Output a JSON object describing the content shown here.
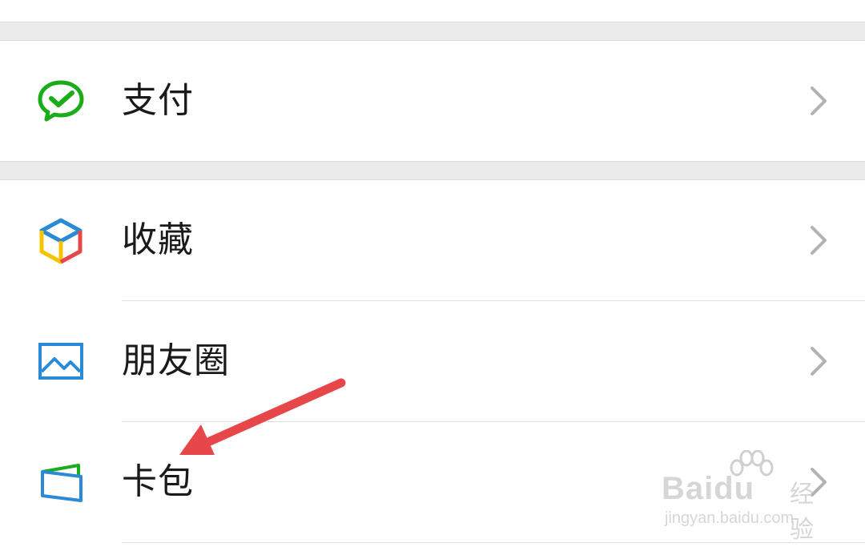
{
  "menu": {
    "items": [
      {
        "label": "支付",
        "icon": "wechat-pay-icon"
      },
      {
        "label": "收藏",
        "icon": "favorites-cube-icon"
      },
      {
        "label": "朋友圈",
        "icon": "moments-picture-icon"
      },
      {
        "label": "卡包",
        "icon": "card-wallet-icon"
      }
    ]
  },
  "colors": {
    "accent_green": "#1aad19",
    "moments_blue": "#2b8ad6",
    "arrow_red": "#e8474a",
    "section_gap": "#ebebeb",
    "chevron": "#b2b2b2"
  },
  "watermark": {
    "brand": "Baidu",
    "suffix": "经验",
    "url": "jingyan.baidu.com"
  }
}
